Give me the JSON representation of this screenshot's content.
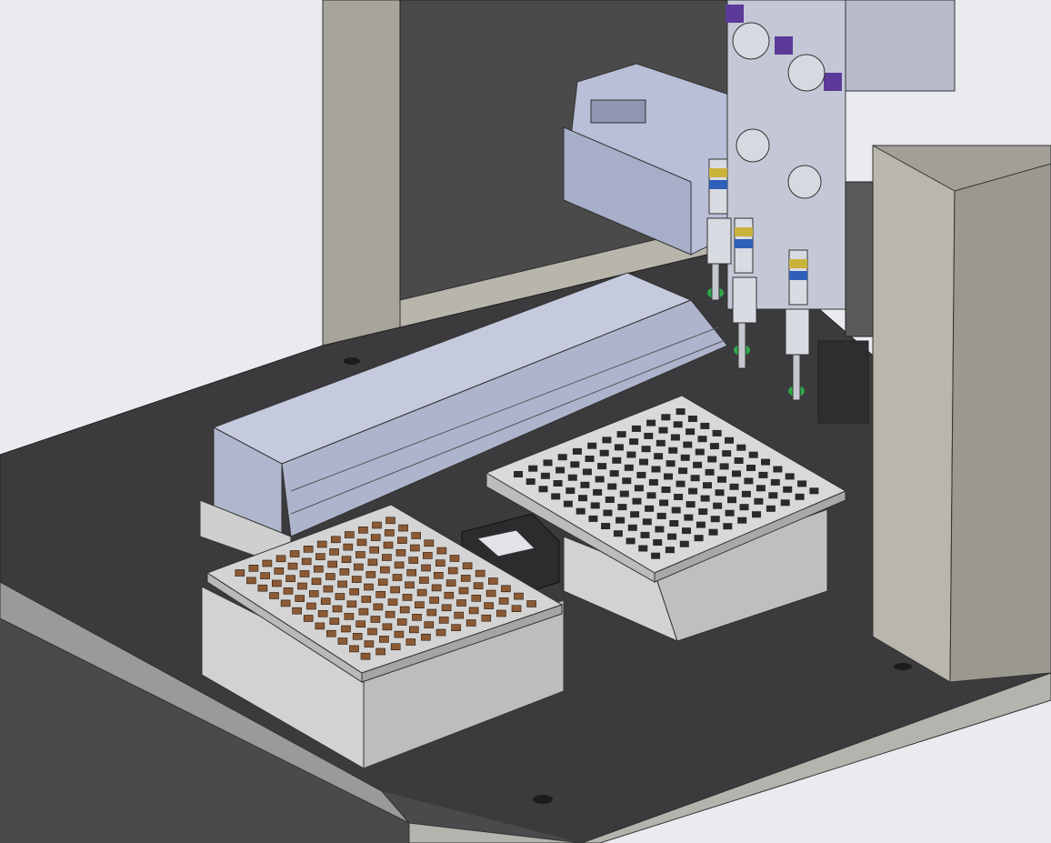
{
  "scene": {
    "background_color": "#e8e9ee",
    "colors": {
      "enclosure": "#a29f97",
      "deck": "#3a3a3c",
      "rail": "#b9bfd6",
      "tray": "#d9d9d9",
      "component": "#8b5a35",
      "nozzle_tip": "#2ea84a",
      "fitting_band": "#c9b23a",
      "clamp": "#5b3a99"
    },
    "tray_left": {
      "rows": 12,
      "cols": 12
    },
    "tray_right": {
      "rows": 12,
      "cols": 12
    },
    "nozzles": {
      "count": 3
    }
  }
}
